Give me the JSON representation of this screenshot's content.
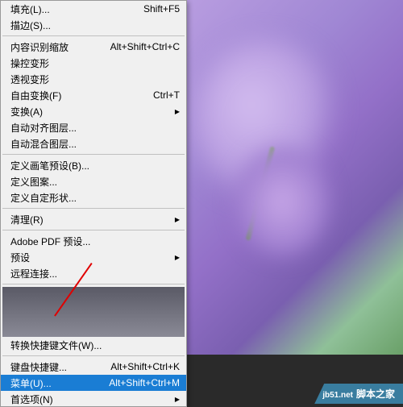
{
  "menu": {
    "fill_partial": {
      "label": "填充(L)...",
      "shortcut": "Shift+F5"
    },
    "stroke": {
      "label": "描边(S)..."
    },
    "content_aware_scale": {
      "label": "内容识别缩放",
      "shortcut": "Alt+Shift+Ctrl+C"
    },
    "puppet_warp": {
      "label": "操控变形"
    },
    "perspective_warp": {
      "label": "透视变形"
    },
    "free_transform": {
      "label": "自由变换(F)",
      "shortcut": "Ctrl+T"
    },
    "transform": {
      "label": "变换(A)"
    },
    "auto_align": {
      "label": "自动对齐图层..."
    },
    "auto_blend": {
      "label": "自动混合图层..."
    },
    "define_brush": {
      "label": "定义画笔预设(B)..."
    },
    "define_pattern": {
      "label": "定义图案..."
    },
    "define_shape": {
      "label": "定义自定形状..."
    },
    "purge": {
      "label": "清理(R)"
    },
    "pdf_presets": {
      "label": "Adobe PDF 预设..."
    },
    "presets": {
      "label": "预设"
    },
    "remote": {
      "label": "远程连接..."
    },
    "convert_shortcuts": {
      "label": "转换快捷键文件(W)..."
    },
    "keyboard_shortcuts": {
      "label": "键盘快捷键...",
      "shortcut": "Alt+Shift+Ctrl+K"
    },
    "menus": {
      "label": "菜单(U)...",
      "shortcut": "Alt+Shift+Ctrl+M"
    },
    "preferences": {
      "label": "首选项(N)"
    }
  },
  "watermark": {
    "site": "jb51.net",
    "brand": "脚本之家"
  }
}
